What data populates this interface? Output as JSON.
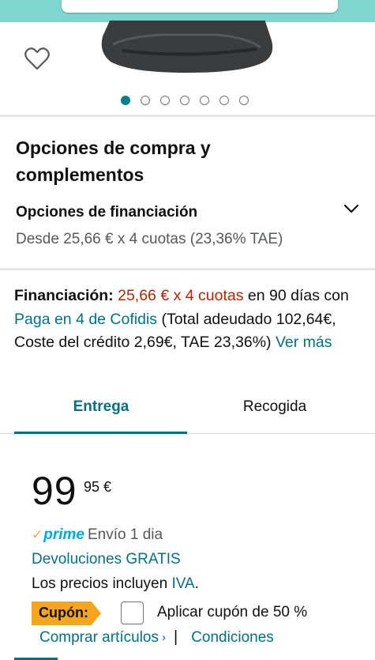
{
  "product": {
    "image_name": "product-stand-image",
    "carousel": {
      "total": 7,
      "active_index": 0
    }
  },
  "purchase_options": {
    "title": "Opciones de compra y complementos",
    "financing_heading": "Opciones de financiación",
    "financing_summary": "Desde 25,66 € x 4 cuotas (23,36% TAE)"
  },
  "financing": {
    "label": "Financiación:",
    "installments": "25,66 € x 4 cuotas",
    "text_1": " en 90 días con ",
    "provider_link": "Paga en 4 de Cofidis",
    "text_2": " (Total adeudado 102,64€, Coste del crédito 2,69€, TAE 23,36%) ",
    "more_link": "Ver más"
  },
  "delivery_tabs": {
    "entrega": "Entrega",
    "recogida": "Recogida",
    "active": "entrega"
  },
  "price": {
    "whole": "99",
    "fraction_currency": "95 €"
  },
  "shipping": {
    "prime_check": "✓",
    "prime_label": "prime",
    "shipping_text": "Envío 1 dia",
    "returns_link": "Devoluciones GRATIS",
    "vat_text": "Los precios incluyen ",
    "vat_link": "IVA",
    "vat_end": "."
  },
  "coupon": {
    "badge_label": "Cupón:",
    "apply_text": "Aplicar cupón de 50 %",
    "buy_link": "Comprar artículos",
    "buy_chevron": "›",
    "separator": "|",
    "conditions_link": "Condiciones"
  },
  "colors": {
    "accent_teal": "#007185",
    "price_red": "#b12704",
    "prime_blue": "#00a8e1",
    "coupon_orange": "#f7a51c"
  }
}
